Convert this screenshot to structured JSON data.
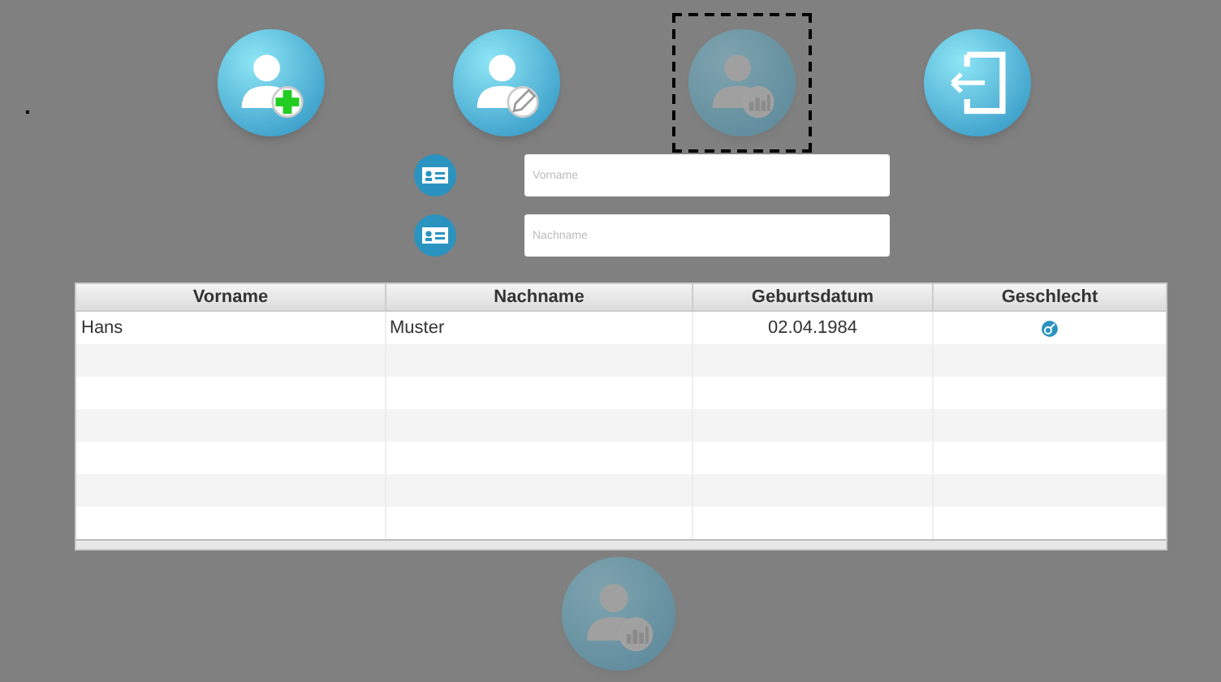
{
  "toolbar": [
    {
      "kind": "add-user",
      "disabled": false,
      "focused": false
    },
    {
      "kind": "edit-user",
      "disabled": false,
      "focused": false
    },
    {
      "kind": "user-stats",
      "disabled": true,
      "focused": true
    },
    {
      "kind": "exit",
      "disabled": false,
      "focused": false
    }
  ],
  "fields": [
    {
      "placeholder": "Vorname"
    },
    {
      "placeholder": "Nachname"
    }
  ],
  "table": {
    "columns": [
      "Vorname",
      "Nachname",
      "Geburtsdatum",
      "Geschlecht"
    ],
    "rows": [
      {
        "cells": [
          "Hans",
          "Muster",
          "02.04.1984"
        ],
        "gender_icon": true
      }
    ]
  },
  "bottom_button": {
    "kind": "user-stats",
    "disabled": true
  }
}
